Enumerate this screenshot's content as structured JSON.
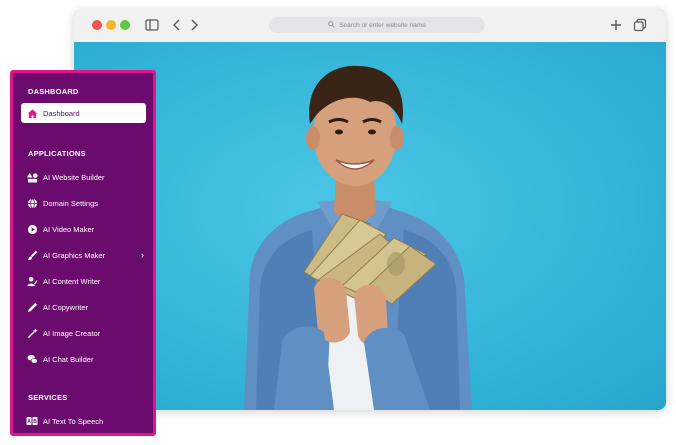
{
  "browser": {
    "url_placeholder": "Search or enter website name"
  },
  "sidebar": {
    "sections": {
      "dashboard": "DASHBOARD",
      "applications": "APPLICATIONS",
      "services": "SERVICES"
    },
    "dashboard_items": [
      {
        "label": "Dashboard",
        "icon": "home-icon",
        "active": true
      }
    ],
    "application_items": [
      {
        "label": "AI Website Builder",
        "icon": "shapes-icon"
      },
      {
        "label": "Domain Settings",
        "icon": "globe-icon"
      },
      {
        "label": "AI Video Maker",
        "icon": "video-icon"
      },
      {
        "label": "AI Graphics Maker",
        "icon": "brush-icon",
        "has_submenu": true
      },
      {
        "label": "AI Content Writer",
        "icon": "user-pen-icon"
      },
      {
        "label": "AI Copywriter",
        "icon": "pen-icon"
      },
      {
        "label": "AI Image Creator",
        "icon": "magic-wand-icon"
      },
      {
        "label": "AI Chat Builder",
        "icon": "chat-icon"
      }
    ],
    "service_items": [
      {
        "label": "AI Text To Speech",
        "icon": "text-speech-icon"
      }
    ],
    "colors": {
      "background": "#6c0b6e",
      "border": "#e0158e",
      "active_bg": "#ffffff",
      "active_icon": "#e0158e"
    }
  },
  "hero": {
    "subject": "photo-man-holding-cash",
    "background": "#3fb9d9"
  }
}
